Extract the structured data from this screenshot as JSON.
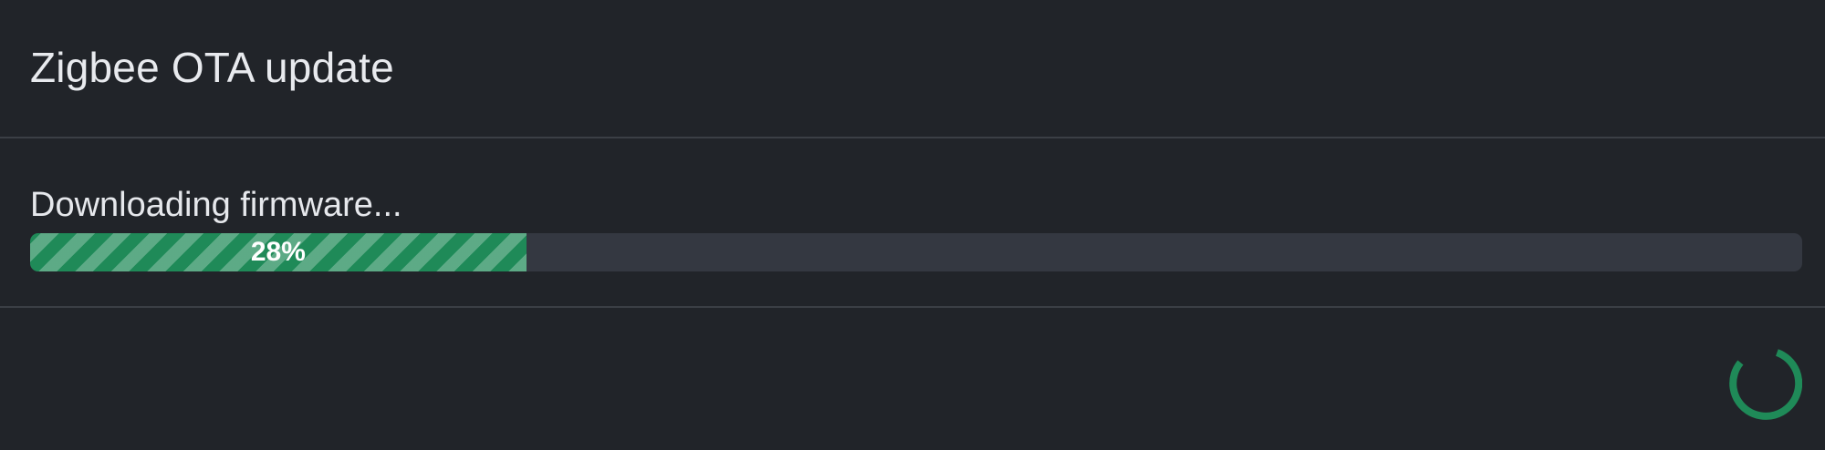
{
  "dialog": {
    "title": "Zigbee OTA update"
  },
  "update": {
    "status_text": "Downloading firmware...",
    "progress_percent": 28,
    "progress_label": "28%"
  },
  "colors": {
    "background": "#212429",
    "accent": "#1f8a58",
    "track": "#343841",
    "divider": "#3b3f45"
  },
  "footer": {
    "spinner_icon": "loading-spinner-icon"
  }
}
